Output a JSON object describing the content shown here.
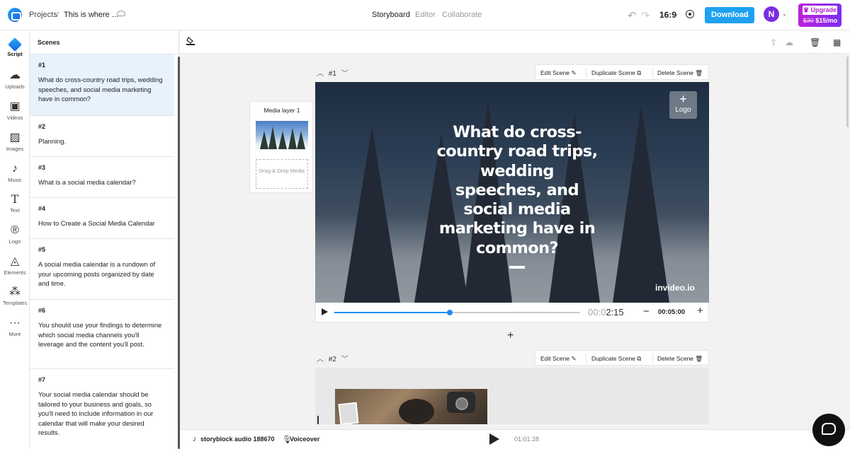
{
  "topbar": {
    "breadcrumb_projects": "Projects",
    "breadcrumb_sep": "/",
    "project_title": "This is where ...",
    "nav": [
      "Storyboard",
      "Editor",
      "Collaborate"
    ],
    "aspect_ratio": "16:9",
    "download_label": "Download",
    "avatar_initial": "N",
    "upgrade_label": "Upgrade",
    "upgrade_old_price": "$30",
    "upgrade_price": "$15/mo"
  },
  "sidebar": {
    "items": [
      {
        "label": "Script",
        "icon": "script-icon"
      },
      {
        "label": "Uploads",
        "icon": "upload-icon"
      },
      {
        "label": "Videos",
        "icon": "video-icon"
      },
      {
        "label": "Images",
        "icon": "image-icon"
      },
      {
        "label": "Music",
        "icon": "music-icon"
      },
      {
        "label": "Text",
        "icon": "text-icon"
      },
      {
        "label": "Logo",
        "icon": "logo-icon"
      },
      {
        "label": "Elements",
        "icon": "elements-icon"
      },
      {
        "label": "Templates",
        "icon": "templates-icon"
      },
      {
        "label": "More",
        "icon": "more-icon"
      }
    ]
  },
  "scenes": {
    "title": "Scenes",
    "items": [
      {
        "num": "#1",
        "text": "What do cross-country road trips, wedding speeches, and social media marketing have in common?"
      },
      {
        "num": "#2",
        "text": "Planning."
      },
      {
        "num": "#3",
        "text": "What is a social media calendar?"
      },
      {
        "num": "#4",
        "text": "How to Create a Social Media Calendar"
      },
      {
        "num": "#5",
        "text": "A social media calendar is a rundown of your upcoming posts organized by date and time."
      },
      {
        "num": "#6",
        "text": "You should use your findings to determine which social media channels you'll leverage and the content you'll post."
      },
      {
        "num": "#7",
        "text": "Your social media calendar should be tailored to your business and goals, so you'll need to include information in our calendar that will make your desired results."
      }
    ]
  },
  "scene_actions": {
    "edit": "Edit Scene",
    "duplicate": "Duplicate Scene",
    "delete": "Delete Scene"
  },
  "scene1": {
    "num": "#1",
    "media_layer": "Media layer 1",
    "drop_label": "Drag & Drop Media",
    "headline": "What do cross-country road trips, wedding speeches, and social media marketing have in common?",
    "logo_label": "Logo",
    "watermark": "invideo.io",
    "current_time_dim": "00:0",
    "current_time": "2:15",
    "duration": "00:05:00",
    "progress": 0.47
  },
  "scene2": {
    "num": "#2"
  },
  "bottom": {
    "audio_name": "storyblock audio 188670",
    "voiceover": "Voiceover",
    "total_time": "01:01:28"
  },
  "colors": {
    "accent": "#1fa0f0",
    "progress": "#1f8ef1",
    "avatar": "#7a2fe0",
    "active_scene": "#e7f2fd"
  }
}
